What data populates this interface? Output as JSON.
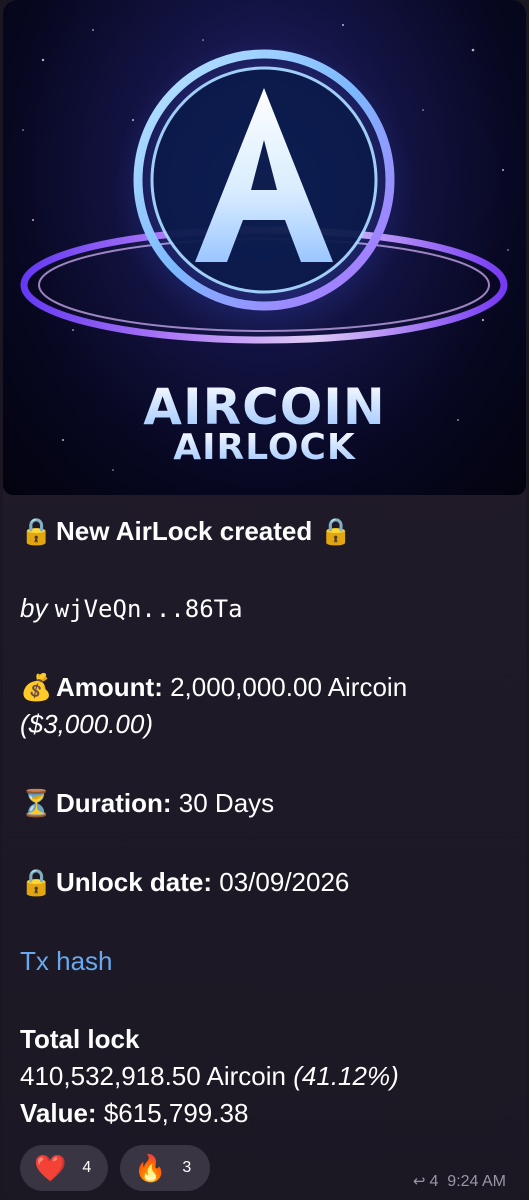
{
  "hero": {
    "logo_letter": "A",
    "title_line1": "AIRCOIN",
    "title_line2": "AIRLOCK"
  },
  "message": {
    "header_emoji": "🔒",
    "header_text": "New AirLock created",
    "header_emoji_end": "🔒",
    "by_label": "by",
    "by_address": "wjVeQn...86Ta",
    "amount_emoji": "💰",
    "amount_label": "Amount:",
    "amount_value": "2,000,000.00 Aircoin",
    "amount_usd": "($3,000.00)",
    "duration_emoji": "⏳",
    "duration_label": "Duration:",
    "duration_value": "30 Days",
    "unlock_emoji": "🔒",
    "unlock_label": "Unlock date:",
    "unlock_value": "03/09/2026",
    "tx_link": "Tx hash",
    "total_lock_label": "Total lock",
    "total_lock_amount": "410,532,918.50 Aircoin",
    "total_lock_percent": "(41.12%)",
    "value_label": "Value:",
    "value_amount": "$615,799.38"
  },
  "reactions": [
    {
      "emoji": "❤️",
      "icon": "heart-icon",
      "count": "4"
    },
    {
      "emoji": "🔥",
      "icon": "fire-icon",
      "count": "3"
    }
  ],
  "meta": {
    "reply_icon": "reply-arrow-icon",
    "reply_count": "4",
    "time": "9:24 AM"
  },
  "colors": {
    "link": "#6aa8ee",
    "bubble_bg": "#231e2c",
    "reaction_bg": "#3a3542",
    "meta_text": "#9b94a6"
  }
}
